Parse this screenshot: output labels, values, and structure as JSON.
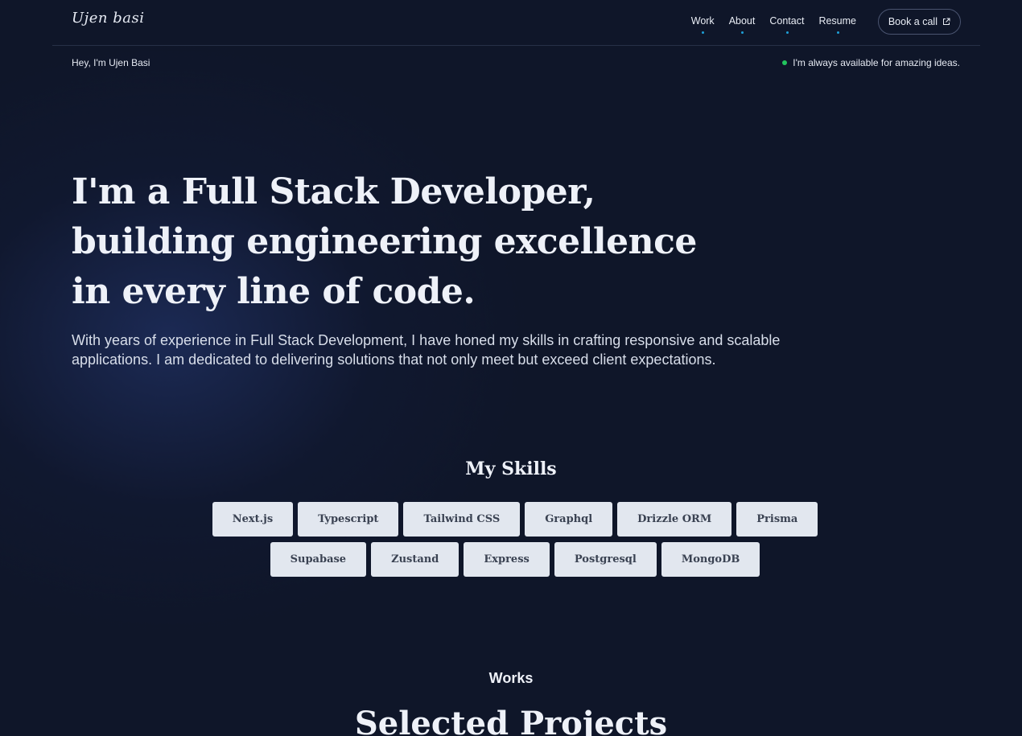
{
  "nav": {
    "logo": "Ujen basi",
    "links": [
      "Work",
      "About",
      "Contact",
      "Resume"
    ],
    "cta_label": "Book a call",
    "cta_icon": "external-link-icon",
    "accent_color": "#1e9fd6"
  },
  "subbar": {
    "greeting": "Hey, I'm Ujen Basi",
    "availability": "I'm always available for amazing ideas.",
    "status_color": "#22c55e"
  },
  "hero": {
    "headline_lines": [
      "I'm a Full Stack Developer,",
      "building engineering excellence",
      "in every line of code."
    ],
    "intro": "With years of experience in Full Stack Development, I have honed my skills in crafting responsive and scalable applications. I am dedicated to delivering solutions that not only meet but exceed client expectations."
  },
  "skills": {
    "title": "My Skills",
    "items": [
      "Next.js",
      "Typescript",
      "Tailwind CSS",
      "Graphql",
      "Drizzle ORM",
      "Prisma",
      "Supabase",
      "Zustand",
      "Express",
      "Postgresql",
      "MongoDB"
    ]
  },
  "works": {
    "label": "Works",
    "title": "Selected Projects"
  }
}
